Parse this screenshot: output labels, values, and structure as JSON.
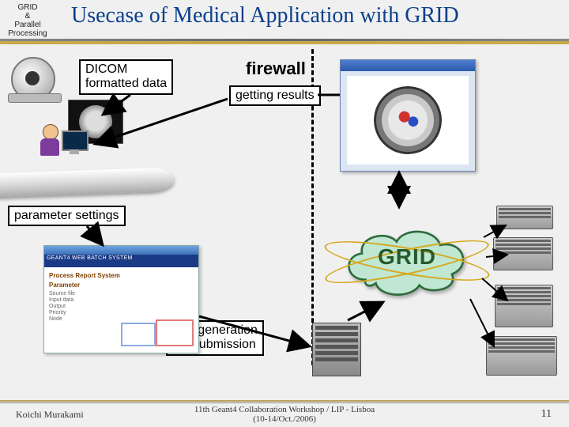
{
  "logo": {
    "line1": "GRID",
    "line2": "&",
    "line3": "Parallel",
    "line4": "Processing"
  },
  "title": "Usecase of Medical Application with GRID",
  "labels": {
    "dicom_line1": "DICOM",
    "dicom_line2": "formatted data",
    "firewall": "firewall",
    "getting_results": "getting results",
    "parameter_settings": "parameter settings",
    "jdl_line1": "JDL generation",
    "jdl_line2": "job submission",
    "grid": "GRID"
  },
  "param_window": {
    "banner": "GEANT4 WEB BATCH SYSTEM",
    "heading1": "Process Report System",
    "heading2": "Parameter",
    "rows": [
      "Source file",
      "Input data",
      "Output",
      "Priority",
      "Node"
    ]
  },
  "footer": {
    "author": "Koichi Murakami",
    "center_line1": "11th Geant4 Collaboration Workshop / LIP - Lisboa",
    "center_line2": "(10-14/Oct./2006)",
    "page": "11"
  }
}
